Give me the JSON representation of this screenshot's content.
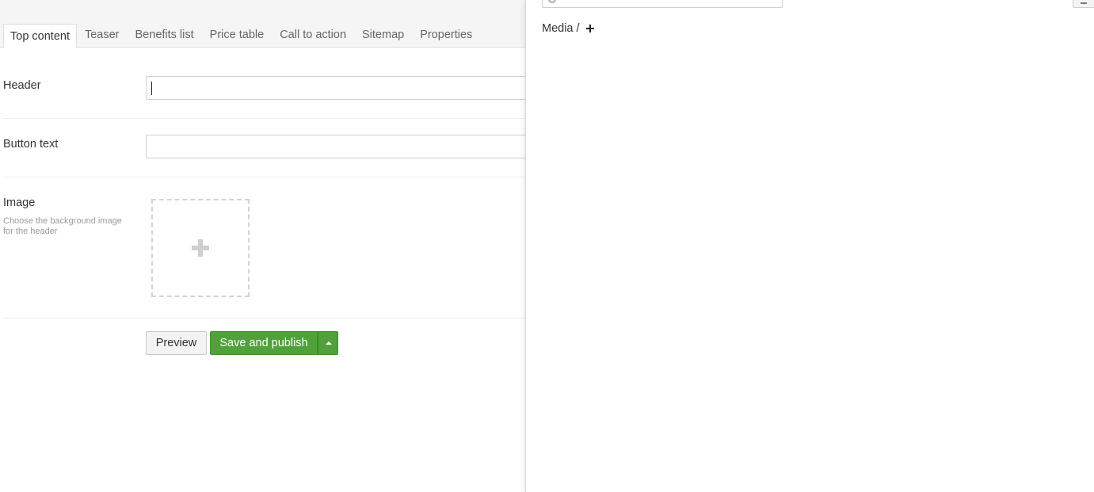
{
  "tabs": [
    {
      "label": "Top content",
      "active": true
    },
    {
      "label": "Teaser"
    },
    {
      "label": "Benefits list"
    },
    {
      "label": "Price table"
    },
    {
      "label": "Call to action"
    },
    {
      "label": "Sitemap"
    },
    {
      "label": "Properties"
    }
  ],
  "fields": {
    "header": {
      "label": "Header",
      "value": ""
    },
    "button_text": {
      "label": "Button text",
      "value": ""
    },
    "image": {
      "label": "Image",
      "description": "Choose the background image for the header",
      "icon": "plus-icon"
    }
  },
  "actions": {
    "preview_label": "Preview",
    "save_label": "Save and publish",
    "accent_color": "#50a13a"
  },
  "media_panel": {
    "breadcrumb_root": "Media",
    "breadcrumb_separator": "/",
    "add_icon": "plus-icon"
  }
}
